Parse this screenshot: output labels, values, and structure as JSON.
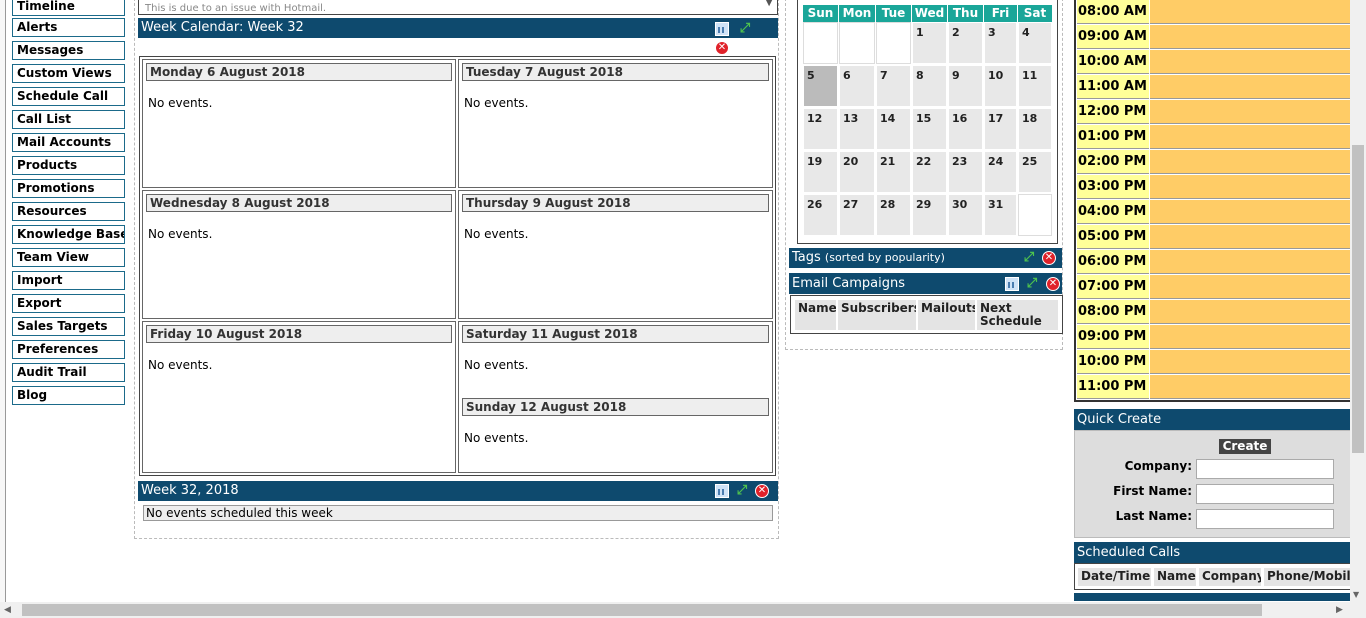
{
  "nav": {
    "items": [
      "Timeline",
      "Alerts",
      "Messages",
      "Custom Views",
      "Schedule Call",
      "Call List",
      "Mail Accounts",
      "Products",
      "Promotions",
      "Resources",
      "Knowledge Base",
      "Team View",
      "Import",
      "Export",
      "Sales Targets",
      "Preferences",
      "Audit Trail",
      "Blog"
    ]
  },
  "notice": {
    "text": "This is due to an issue with Hotmail."
  },
  "week_calendar": {
    "title": "Week Calendar: Week 32",
    "days": [
      {
        "label": "Monday 6 August 2018",
        "events": "No events."
      },
      {
        "label": "Tuesday 7 August 2018",
        "events": "No events."
      },
      {
        "label": "Wednesday 8 August 2018",
        "events": "No events."
      },
      {
        "label": "Thursday 9 August 2018",
        "events": "No events."
      },
      {
        "label": "Friday 10 August 2018",
        "events": "No events."
      },
      {
        "label": "Saturday 11 August 2018",
        "events": "No events."
      },
      {
        "label": "Sunday 12 August 2018",
        "events": "No events."
      }
    ]
  },
  "week_summary": {
    "title": "Week 32, 2018",
    "text": "No events scheduled this week"
  },
  "mini_calendar": {
    "weekdays": [
      "Sun",
      "Mon",
      "Tue",
      "Wed",
      "Thu",
      "Fri",
      "Sat"
    ],
    "weeks": [
      [
        "",
        "",
        "",
        "1",
        "2",
        "3",
        "4"
      ],
      [
        "5",
        "6",
        "7",
        "8",
        "9",
        "10",
        "11"
      ],
      [
        "12",
        "13",
        "14",
        "15",
        "16",
        "17",
        "18"
      ],
      [
        "19",
        "20",
        "21",
        "22",
        "23",
        "24",
        "25"
      ],
      [
        "26",
        "27",
        "28",
        "29",
        "30",
        "31",
        ""
      ]
    ],
    "highlighted_day": "5"
  },
  "tags": {
    "title": "Tags",
    "subtitle": "(sorted by popularity)"
  },
  "email_campaigns": {
    "title": "Email Campaigns",
    "columns": [
      "Name",
      "Subscribers",
      "Mailouts",
      "Next Schedule"
    ]
  },
  "day_schedule": {
    "times": [
      "08:00 AM",
      "09:00 AM",
      "10:00 AM",
      "11:00 AM",
      "12:00 PM",
      "01:00 PM",
      "02:00 PM",
      "03:00 PM",
      "04:00 PM",
      "05:00 PM",
      "06:00 PM",
      "07:00 PM",
      "08:00 PM",
      "09:00 PM",
      "10:00 PM",
      "11:00 PM"
    ],
    "colors": {
      "time_bg": "#ffff99",
      "slot_bg": "#ffcc66"
    }
  },
  "quick_create": {
    "title": "Quick Create",
    "create_label": "Create",
    "fields": [
      "Company:",
      "First Name:",
      "Last Name:"
    ]
  },
  "scheduled_calls": {
    "title": "Scheduled Calls",
    "columns": [
      "Date/Time",
      "Name",
      "Company",
      "Phone/Mobile"
    ]
  },
  "colors": {
    "header": "#0e4a6e",
    "calendar_head": "#1aa699",
    "nav_border": "#1b6a8a"
  }
}
